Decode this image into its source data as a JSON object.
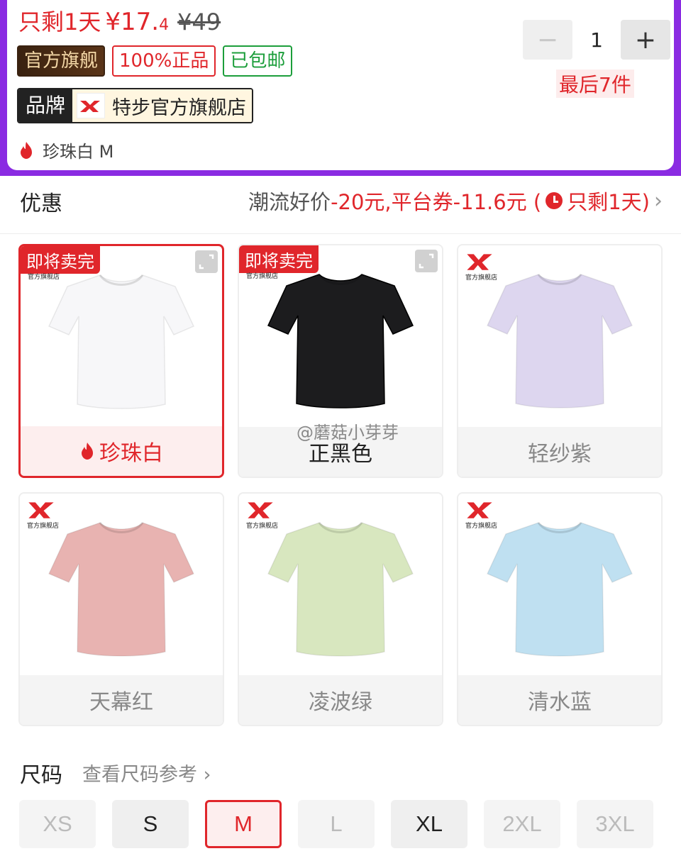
{
  "header": {
    "price_prefix": "只剩1天",
    "price_symbol_value": "¥17.",
    "price_decimal": "4",
    "original_price": "¥49",
    "badges": [
      "官方旗舰",
      "100%正品",
      "已包邮"
    ],
    "brand_label": "品牌",
    "store_name": "特步官方旗舰店",
    "selected_variant": "珍珠白 M",
    "quantity": "1",
    "minus": "−",
    "plus": "+",
    "stock_note": "最后7件"
  },
  "promo": {
    "label": "优惠",
    "part1": "潮流好价",
    "part2": "-20元,",
    "part3": "平台券-11.6元 (",
    "part4": "只剩1天)",
    "chevron": "›"
  },
  "colors": [
    {
      "name": "珍珠白",
      "tag": "即将卖完",
      "shirt": "#f7f7f9",
      "selected": true
    },
    {
      "name": "正黑色",
      "tag": "即将卖完",
      "shirt": "#1c1c1e",
      "selected": false
    },
    {
      "name": "轻纱紫",
      "tag": "",
      "shirt": "#ddd6ef",
      "selected": false
    },
    {
      "name": "天幕红",
      "tag": "",
      "shirt": "#e8b3b1",
      "selected": false
    },
    {
      "name": "凌波绿",
      "tag": "",
      "shirt": "#d8e7bf",
      "selected": false
    },
    {
      "name": "清水蓝",
      "tag": "",
      "shirt": "#bfe0f1",
      "selected": false
    }
  ],
  "tile_store_text": "官方旗舰店",
  "watermark": "@蘑菇小芽芽",
  "size": {
    "title": "尺码",
    "guide": "查看尺码参考 ›",
    "options": [
      "XS",
      "S",
      "M",
      "L",
      "XL",
      "2XL",
      "3XL"
    ],
    "available": [
      "S",
      "XL"
    ],
    "selected": "M"
  },
  "accent_color": "#e0262b"
}
